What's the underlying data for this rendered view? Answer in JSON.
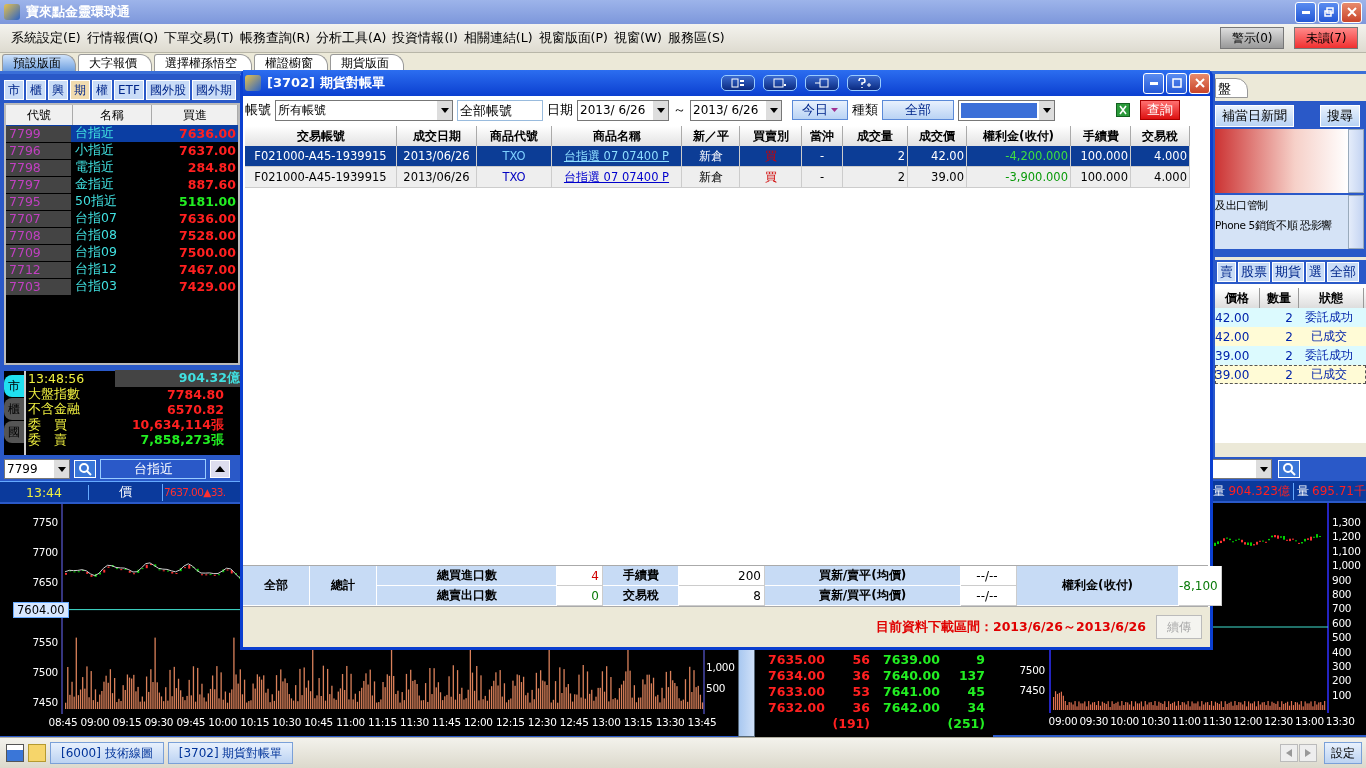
{
  "window": {
    "title": "寶來點金靈環球通"
  },
  "menu": [
    "系統設定(E)",
    "行情報價(Q)",
    "下單交易(T)",
    "帳務查詢(R)",
    "分析工具(A)",
    "投資情報(I)",
    "相關連結(L)",
    "視窗版面(P)",
    "視窗(W)",
    "服務區(S)"
  ],
  "alerts": [
    {
      "label": "警示(0)",
      "kind": "plain"
    },
    {
      "label": "未讀(7)",
      "kind": "alert"
    }
  ],
  "layout_tabs": [
    {
      "label": "預設版面",
      "selected": true
    },
    {
      "label": "大字報價",
      "selected": false
    },
    {
      "label": "選擇權孫悟空",
      "selected": false
    },
    {
      "label": "權證櫥窗",
      "selected": false
    },
    {
      "label": "期貨版面",
      "selected": false
    }
  ],
  "market_tabs": [
    {
      "label": "市",
      "selected": false
    },
    {
      "label": "櫃",
      "selected": false
    },
    {
      "label": "興",
      "selected": false
    },
    {
      "label": "期",
      "selected": true
    },
    {
      "label": "權",
      "selected": false
    },
    {
      "label": "ETF",
      "selected": false
    },
    {
      "label": "國外股",
      "selected": false
    },
    {
      "label": "國外期",
      "selected": false
    }
  ],
  "quote_table": {
    "columns": [
      "代號",
      "名稱",
      "買進"
    ],
    "rows": [
      {
        "code": "7799",
        "name": "台指近",
        "bid": "7636.00",
        "kind": "up",
        "selected": true
      },
      {
        "code": "7796",
        "name": "小指近",
        "bid": "7637.00",
        "kind": "up",
        "selected": false
      },
      {
        "code": "7798",
        "name": "電指近",
        "bid": "284.80",
        "kind": "up",
        "selected": false
      },
      {
        "code": "7797",
        "name": "金指近",
        "bid": "887.60",
        "kind": "up",
        "selected": false
      },
      {
        "code": "7795",
        "name": "50指近",
        "bid": "5181.00",
        "kind": "down",
        "selected": false
      },
      {
        "code": "7707",
        "name": "台指07",
        "bid": "7636.00",
        "kind": "up",
        "selected": false
      },
      {
        "code": "7708",
        "name": "台指08",
        "bid": "7528.00",
        "kind": "up",
        "selected": false
      },
      {
        "code": "7709",
        "name": "台指09",
        "bid": "7500.00",
        "kind": "up",
        "selected": false
      },
      {
        "code": "7712",
        "name": "台指12",
        "bid": "7467.00",
        "kind": "up",
        "selected": false
      },
      {
        "code": "7703",
        "name": "台指03",
        "bid": "7429.00",
        "kind": "up",
        "selected": false
      }
    ]
  },
  "market_summary": {
    "side_tabs": [
      {
        "label": "市",
        "selected": true
      },
      {
        "label": "櫃",
        "selected": false
      },
      {
        "label": "國",
        "selected": false
      }
    ],
    "time": "13:48:56",
    "turnover": "904.32億",
    "rows": [
      {
        "label": "大盤指數",
        "value": "7784.80",
        "kind": "up"
      },
      {
        "label": "不含金融",
        "value": "6570.82",
        "kind": "up"
      },
      {
        "label": "委　買",
        "value": "10,634,114張",
        "kind": "up"
      },
      {
        "label": "委　賣",
        "value": "7,858,273張",
        "kind": "down"
      }
    ]
  },
  "chart_panel": {
    "symbol": "7799",
    "name": "台指近",
    "time": "13:44",
    "price_label": "價",
    "price": "7637.00▲33.",
    "price_ticks": [
      "7750",
      "7700",
      "7650",
      "7550",
      "7500",
      "7450"
    ],
    "marker": "7604.00",
    "volume_ticks": [
      "1,000",
      "500"
    ],
    "time_ticks": [
      "08:45",
      "09:00",
      "09:15",
      "09:30",
      "09:45",
      "10:00",
      "10:15",
      "10:30",
      "10:45",
      "11:00",
      "11:15",
      "11:30",
      "11:45",
      "12:00",
      "12:15",
      "12:30",
      "12:45",
      "13:00",
      "13:15",
      "13:30",
      "13:45"
    ]
  },
  "order_book": {
    "rows": [
      {
        "bid": "7635.00",
        "bid_qty": "56",
        "ask": "7639.00",
        "ask_qty": "9"
      },
      {
        "bid": "7634.00",
        "bid_qty": "36",
        "ask": "7640.00",
        "ask_qty": "137"
      },
      {
        "bid": "7633.00",
        "bid_qty": "53",
        "ask": "7641.00",
        "ask_qty": "45"
      },
      {
        "bid": "7632.00",
        "bid_qty": "36",
        "ask": "7642.00",
        "ask_qty": "34"
      }
    ],
    "bid_total": "(191)",
    "ask_total": "(251)"
  },
  "right_panel": {
    "tab": "盤",
    "news_button": "補當日新聞",
    "search_button": "搜尋",
    "news": [
      "及出口管制",
      "Phone 5銷貨不順 恐影響"
    ],
    "order_filters": [
      "賣",
      "股票",
      "期貨",
      "選",
      "全部"
    ],
    "orders": {
      "columns": [
        "價格",
        "數量",
        "狀態"
      ],
      "rows": [
        {
          "price": "42.00",
          "qty": "2",
          "status": "委託成功",
          "kind": "pending",
          "selected": false
        },
        {
          "price": "42.00",
          "qty": "2",
          "status": "已成交",
          "kind": "filled",
          "selected": false
        },
        {
          "price": "39.00",
          "qty": "2",
          "status": "委託成功",
          "kind": "pending",
          "selected": false
        },
        {
          "price": "39.00",
          "qty": "2",
          "status": "已成交",
          "kind": "filled",
          "selected": true
        }
      ]
    },
    "volume_info": [
      "量",
      "904.323億",
      "量",
      "695.71千"
    ],
    "price_ticks": [
      "7500",
      "7450"
    ],
    "volume_ticks": [
      "1,300",
      "1,200",
      "1,100",
      "1,000",
      "900",
      "800",
      "700",
      "600",
      "500",
      "400",
      "300",
      "200",
      "100"
    ],
    "time_ticks": [
      "09:00",
      "09:30",
      "10:00",
      "10:30",
      "11:00",
      "11:30",
      "12:00",
      "12:30",
      "13:00",
      "13:30"
    ]
  },
  "dialog": {
    "title": "[3702] 期貨對帳單",
    "filters": {
      "account_label": "帳號",
      "account": "所有帳號",
      "account_name": "全部帳號",
      "date_label": "日期",
      "date_from": "2013/ 6/26",
      "range_sep": "～",
      "date_to": "2013/ 6/26",
      "today_button": "今日",
      "type_label": "種類",
      "type_button": "全部",
      "query_button": "查詢"
    },
    "columns": [
      "交易帳號",
      "成交日期",
      "商品代號",
      "商品名稱",
      "新／平",
      "買賣別",
      "當沖",
      "成交量",
      "成交價",
      "權利金(收付)",
      "手續費",
      "交易稅"
    ],
    "rows": [
      {
        "account": "F021000-A45-1939915",
        "date": "2013/06/26",
        "code": "TXO",
        "name": "台指選 07 07400 P",
        "open_close": "新倉",
        "side": "買",
        "day_trade": "-",
        "qty": "2",
        "price": "42.00",
        "premium": "-4,200.000",
        "fee": "100.000",
        "tax": "4.000",
        "selected": true
      },
      {
        "account": "F021000-A45-1939915",
        "date": "2013/06/26",
        "code": "TXO",
        "name": "台指選 07 07400 P",
        "open_close": "新倉",
        "side": "買",
        "day_trade": "-",
        "qty": "2",
        "price": "39.00",
        "premium": "-3,900.000",
        "fee": "100.000",
        "tax": "4.000",
        "selected": false
      }
    ],
    "summary": {
      "all": "全部",
      "total": "總計",
      "buy_label": "總買進口數",
      "buy_count": "4",
      "sell_label": "總賣出口數",
      "sell_count": "0",
      "fee_label": "手續費",
      "fee": "200",
      "tax_label": "交易稅",
      "tax": "8",
      "buy_avg_label": "買新/賣平(均價)",
      "buy_avg": "--/--",
      "sell_avg_label": "賣新/買平(均價)",
      "sell_avg": "--/--",
      "premium_label": "權利金(收付)",
      "premium": "-8,100"
    },
    "range_note": "目前資料下載區間：2013/6/26～2013/6/26",
    "resume_button": {
      "label": "續傳",
      "disabled": true
    }
  },
  "taskbar": {
    "items": [
      "[6000] 技術線圖",
      "[3702] 期貨對帳單"
    ],
    "settings": "設定"
  }
}
